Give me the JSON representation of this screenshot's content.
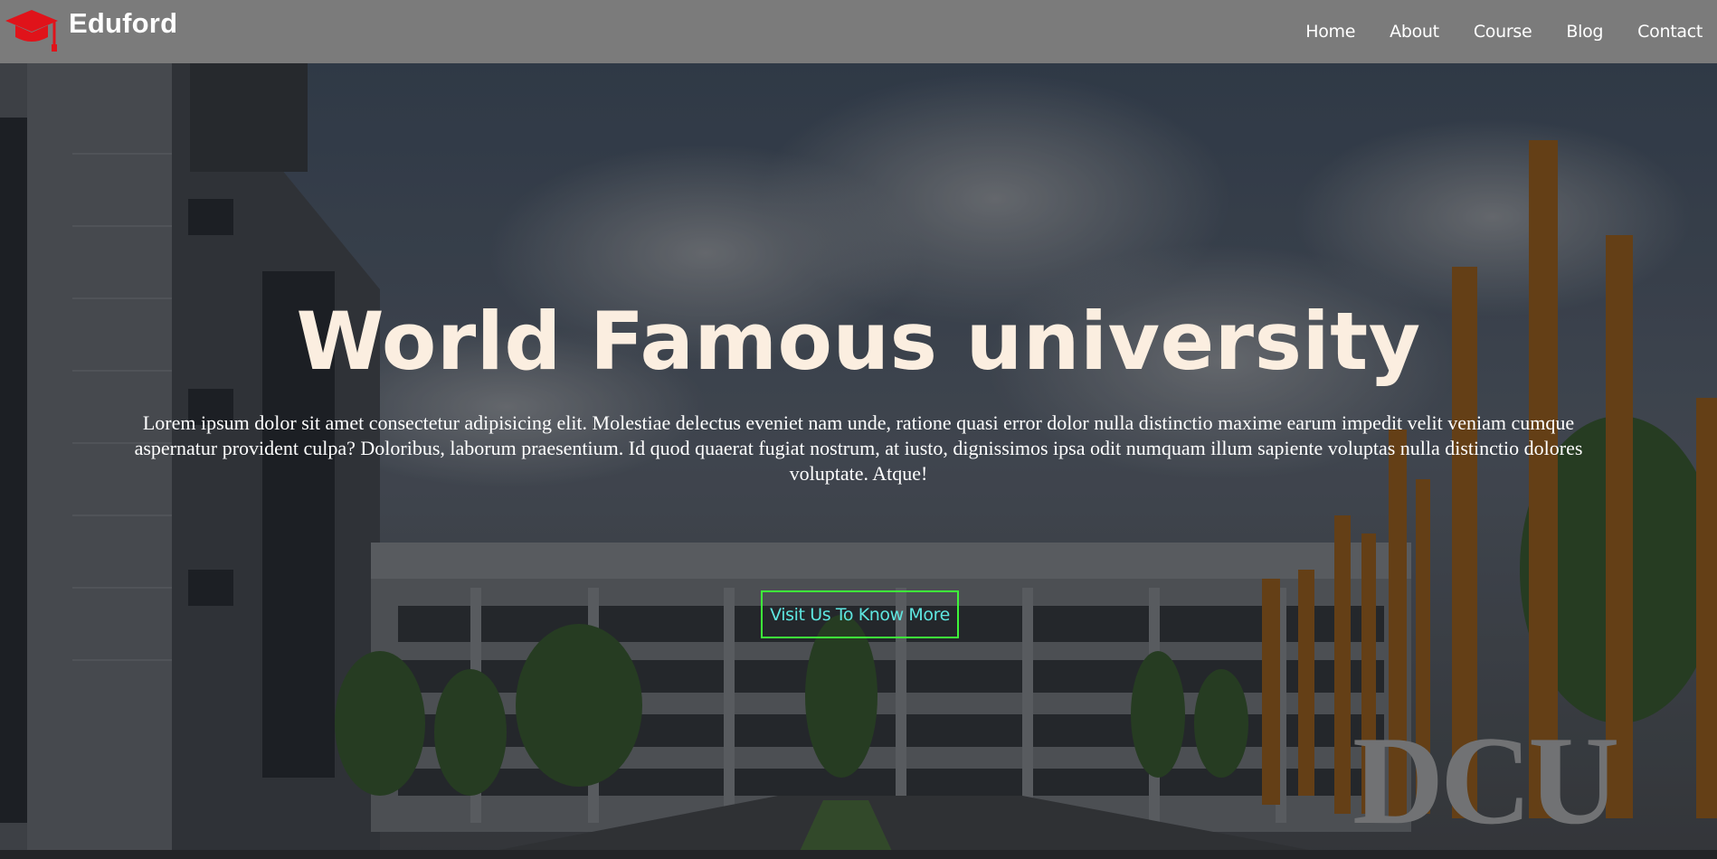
{
  "brand": {
    "name": "Eduford",
    "icon": "graduation-cap-icon",
    "icon_color": "#e0131a"
  },
  "nav": {
    "items": [
      {
        "label": "Home"
      },
      {
        "label": "About"
      },
      {
        "label": "Course"
      },
      {
        "label": "Blog"
      },
      {
        "label": "Contact"
      }
    ]
  },
  "hero": {
    "title": "World Famous university",
    "text": "Lorem ipsum dolor sit amet consectetur adipisicing elit. Molestiae delectus eveniet nam unde, ratione quasi error dolor nulla distinctio maxime earum impedit velit veniam cumque aspernatur provident culpa? Doloribus, laborum praesentium. Id quod quaerat fugiat nostrum, at iusto, dignissimos ipsa odit numquam illum sapiente voluptas nulla distinctio dolores voluptate. Atque!",
    "cta_label": "Visit Us To Know More",
    "campus_sign": "DCU"
  },
  "colors": {
    "header_bg": "#7b7b7b",
    "title": "#fbeee0",
    "cta_border": "#3ef53a",
    "cta_text": "#5ee6e0"
  }
}
